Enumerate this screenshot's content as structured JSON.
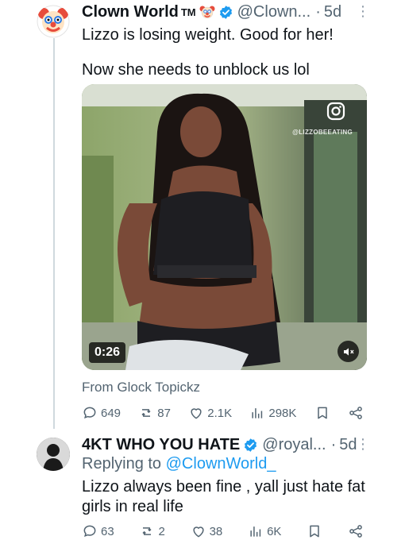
{
  "tweet1": {
    "display_name": "Clown World",
    "tm": "TM",
    "handle": "@Clown...",
    "dot": "·",
    "time": "5d",
    "text_line1": "Lizzo is losing weight. Good for her!",
    "text_line2": "Now she needs to unblock us lol",
    "media": {
      "duration": "0:26",
      "watermark": "@LIZZOBEEATING"
    },
    "attribution": "From Glock Topickz",
    "stats": {
      "replies": "649",
      "reposts": "87",
      "likes": "2.1K",
      "views": "298K"
    }
  },
  "tweet2": {
    "display_name": "4KT WHO YOU HATE",
    "handle": "@royal...",
    "dot": "·",
    "time": "5d",
    "replying_prefix": "Replying to",
    "replying_to": "@ClownWorld_",
    "text_line1": "Lizzo always been fine , yall just hate fat",
    "text_line2": "girls in real life",
    "stats": {
      "replies": "63",
      "reposts": "2",
      "likes": "38",
      "views": "6K"
    }
  },
  "colors": {
    "link": "#1d9bf0",
    "muted": "#536471",
    "verified": "#1d9bf0"
  }
}
